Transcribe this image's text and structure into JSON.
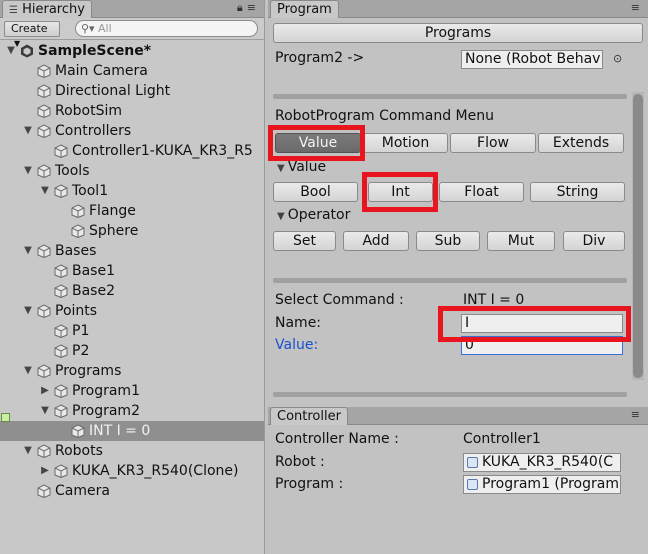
{
  "hierarchy": {
    "tab_label": "Hierarchy",
    "create_label": "Create",
    "search_placeholder": "All",
    "items": [
      {
        "label": "SampleScene*"
      },
      {
        "label": "Main Camera"
      },
      {
        "label": "Directional Light"
      },
      {
        "label": "RobotSim"
      },
      {
        "label": "Controllers"
      },
      {
        "label": "Controller1-KUKA_KR3_R5"
      },
      {
        "label": "Tools"
      },
      {
        "label": "Tool1"
      },
      {
        "label": "Flange"
      },
      {
        "label": "Sphere"
      },
      {
        "label": "Bases"
      },
      {
        "label": "Base1"
      },
      {
        "label": "Base2"
      },
      {
        "label": "Points"
      },
      {
        "label": "P1"
      },
      {
        "label": "P2"
      },
      {
        "label": "Programs"
      },
      {
        "label": "Program1"
      },
      {
        "label": "Program2"
      },
      {
        "label": "INT I = 0"
      },
      {
        "label": "Robots"
      },
      {
        "label": "KUKA_KR3_R540(Clone)"
      },
      {
        "label": "Camera"
      }
    ]
  },
  "program": {
    "tab_label": "Program",
    "programs_button": "Programs",
    "program_label": "Program2 ->",
    "program_value": "None (Robot Behav",
    "menu_title": "RobotProgram Command Menu",
    "categories": [
      {
        "label": "Value"
      },
      {
        "label": "Motion"
      },
      {
        "label": "Flow"
      },
      {
        "label": "Extends"
      }
    ],
    "value_section": "Value",
    "value_buttons": [
      {
        "label": "Bool"
      },
      {
        "label": "Int"
      },
      {
        "label": "Float"
      },
      {
        "label": "String"
      }
    ],
    "operator_section": "Operator",
    "operator_buttons": [
      {
        "label": "Set"
      },
      {
        "label": "Add"
      },
      {
        "label": "Sub"
      },
      {
        "label": "Mut"
      },
      {
        "label": "Div"
      }
    ],
    "select_command_label": "Select Command :",
    "select_command_value": "INT I = 0",
    "name_label": "Name:",
    "name_value": "I",
    "value_label": "Value:",
    "value_value": "0"
  },
  "controller": {
    "tab_label": "Controller",
    "name_label": "Controller Name :",
    "name_value": "Controller1",
    "robot_label": "Robot :",
    "robot_value": "KUKA_KR3_R540(C",
    "program_label": "Program :",
    "program_value": "Program1 (Program"
  },
  "colors": {
    "highlight": "#e8141e",
    "link_label": "#1a4fd0"
  }
}
